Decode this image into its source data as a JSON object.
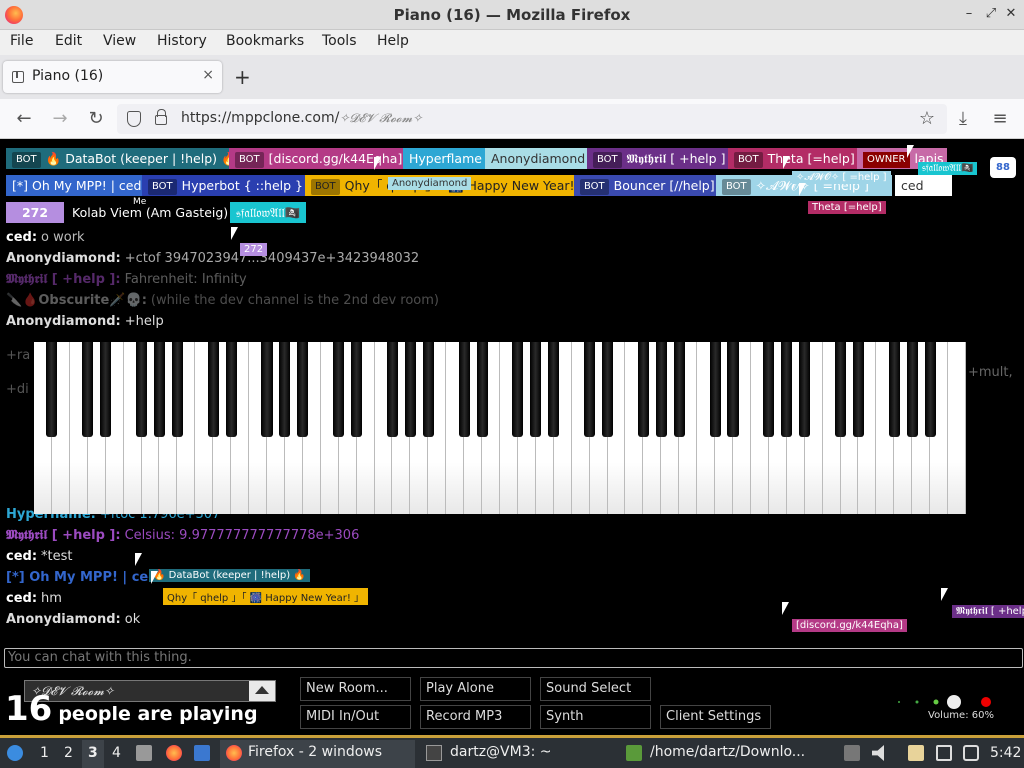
{
  "window": {
    "title": "Piano (16) — Mozilla Firefox",
    "minimize": "–",
    "maximize": "⤢",
    "close": "✕"
  },
  "menu": [
    "File",
    "Edit",
    "View",
    "History",
    "Bookmarks",
    "Tools",
    "Help"
  ],
  "tab": {
    "title": "Piano (16)",
    "close": "×",
    "new_tab": "+"
  },
  "nav": {
    "back": "←",
    "forward": "→",
    "reload": "↻",
    "url_prefix": "https://mppclone.com/",
    "url_room": "✧𝓓𝓔𝓥 𝓡𝓸𝓸𝓶✧",
    "bookmark_star": "☆",
    "download": "⤓",
    "menu": "≡"
  },
  "users": {
    "row1": [
      {
        "tag": "BOT",
        "name": "🔥 DataBot (keeper | !help) 🔥",
        "color": "#1f6c7c"
      },
      {
        "tag": "BOT",
        "name": "[discord.gg/k44Eqha]",
        "color": "#b43a86"
      },
      {
        "tag": "",
        "name": "Hyperflame",
        "color": "#2da7d4"
      },
      {
        "tag": "",
        "name": "Anonydiamond",
        "color": "#a9dde6"
      },
      {
        "tag": "BOT",
        "name": "𝕸𝖞𝖙𝖍𝖗𝖎𝖑 [ +help ]",
        "color": "#6b2f88"
      },
      {
        "tag": "BOT",
        "name": "Theta [=help]",
        "color": "#b32c66"
      },
      {
        "tag": "OWNER",
        "name": "lapis",
        "color": "#c76aa7"
      }
    ],
    "row2": [
      {
        "tag": "",
        "name": "[*] Oh My MPP! | ced",
        "color": "#3366cc"
      },
      {
        "tag": "BOT",
        "name": "Hyperbot { ::help }",
        "color": "#2a3fb0"
      },
      {
        "tag": "BOT",
        "name": "Qhy「 qhelp 」「 🎆 Happy New Year! 」",
        "color": "#f0b400"
      },
      {
        "tag": "BOT",
        "name": "Bouncer [//help]",
        "color": "#3a4ab0"
      },
      {
        "tag": "BOT",
        "name": "✧𝓐𝓦𝓞✧ [ =help ]",
        "color": "#9fd5e8"
      },
      {
        "tag": "",
        "name": "ced",
        "color": "#ffffff"
      }
    ],
    "row3": [
      {
        "tag": "",
        "name": "272",
        "color": "#b58ee0"
      },
      {
        "tag": "",
        "name": "Kolab Viem (Am Gasteig)",
        "color": "#000000"
      },
      {
        "tag": "",
        "name": "𝔰𝔣𝔞𝔩𝔩𝔬𝔴𝔄𝔩𝔩🏴‍☠️",
        "color": "#19c5d0"
      }
    ],
    "me_label": "Me",
    "user_count_icon": "88"
  },
  "cursors": [
    {
      "name": "Anonydiamond",
      "color": "#a9dde6"
    },
    {
      "name": "𝔰𝔣𝔞𝔩𝔩𝔬𝔴𝔄𝔩𝔩🏴‍☠️",
      "color": "#19c5d0"
    },
    {
      "name": "✧𝓐𝓦𝓞✧ [ =help ]",
      "color": "#9fd5e8"
    },
    {
      "name": "Theta [=help]",
      "color": "#b32c66"
    },
    {
      "name": "272",
      "color": "#b58ee0"
    },
    {
      "name": "🔥 DataBot (keeper | !help) 🔥",
      "color": "#1f6c7c"
    },
    {
      "name": "Qhy「 qhelp 」「 🎆 Happy New Year! 」",
      "color": "#f0b400"
    },
    {
      "name": "[discord.gg/k44Eqha]",
      "color": "#b43a86"
    },
    {
      "name": "𝕸𝖞𝖙𝖍𝖗𝖎𝖑 [ +help ]",
      "color": "#6b2f88"
    }
  ],
  "chat": [
    {
      "nick": "ced:",
      "text": "o work",
      "color": "#ffffff",
      "faded": false
    },
    {
      "nick": "Anonydiamond:",
      "text": "+ctof 3947023947...3409437e+3423948032",
      "color": "#cccccc",
      "faded": false
    },
    {
      "nick": "𝕸𝖞𝖙𝖍𝖗𝖎𝖑 [ +help ]:",
      "text": "Fahrenheit: Infinity",
      "color": "#7a3a9a",
      "faded": true
    },
    {
      "nick": "🔪🩸Obscurite🗡️💀:",
      "text": "(while the dev channel is the 2nd dev room)",
      "color": "#aaaaaa",
      "faded": true
    },
    {
      "nick": "Anonydiamond:",
      "text": "+help",
      "color": "#cccccc",
      "faded": false
    },
    {
      "nick": "Hyperflame:",
      "text": "+ftoc 1.796e+307",
      "color": "#2da7d4",
      "faded": false
    },
    {
      "nick": "𝕸𝖞𝖙𝖍𝖗𝖎𝖑 [ +help ]:",
      "text": "Celsius: 9.977777777777778e+306",
      "color": "#9b4bc0",
      "faded": false
    },
    {
      "nick": "ced:",
      "text": "*test",
      "color": "#ffffff",
      "faded": false
    },
    {
      "nick": "[*] Oh My MPP! | ced:",
      "text": "",
      "color": "#3366cc",
      "faded": false
    },
    {
      "nick": "ced:",
      "text": "hm",
      "color": "#ffffff",
      "faded": false
    },
    {
      "nick": "Anonydiamond:",
      "text": "ok",
      "color": "#cccccc",
      "faded": false
    }
  ],
  "chat_behind_piano": {
    "right_text": "+mult,",
    "left_fragments": [
      "+ra",
      "+di"
    ]
  },
  "chat_input": {
    "placeholder": "You can chat with this thing."
  },
  "bottom": {
    "room": "✧𝓓𝓔𝓥 𝓡𝓸𝓸𝓶✧",
    "people_count": "16",
    "people_label": "people are playing",
    "buttons": [
      "New Room...",
      "Play Alone",
      "Sound Select",
      "MIDI In/Out",
      "Record MP3",
      "Synth",
      "Client Settings"
    ],
    "volume_label": "Volume: 60%",
    "volume": 0.6
  },
  "taskbar": {
    "workspaces": [
      "1",
      "2",
      "3",
      "4"
    ],
    "active_workspace": "3",
    "windows": [
      {
        "label": "Firefox - 2 windows",
        "icon": "firefox-icon"
      },
      {
        "label": "dartz@VM3: ~",
        "icon": "terminal-icon"
      },
      {
        "label": "/home/dartz/Downlo...",
        "icon": "folder-icon"
      }
    ],
    "clock": "5:42"
  }
}
